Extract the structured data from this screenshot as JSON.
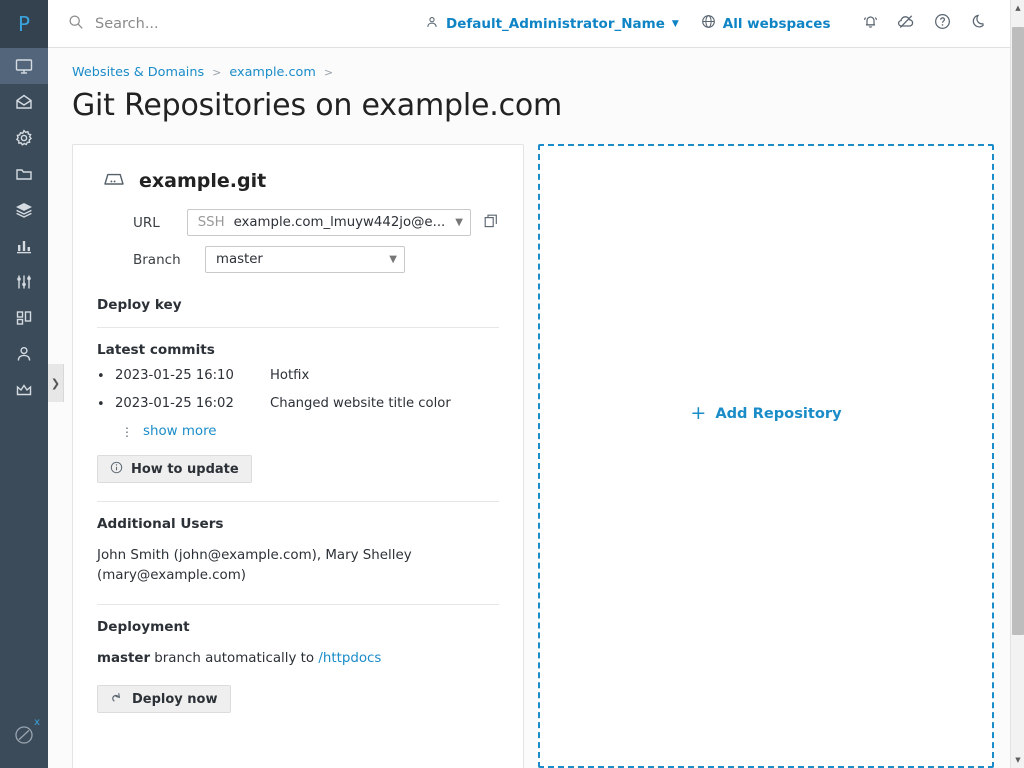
{
  "brand": {
    "logo_letter": "P",
    "accent": "#1a8cc8",
    "sidebar_bg": "#3b4b5a"
  },
  "header": {
    "search_placeholder": "Search...",
    "search_value": "",
    "account_name": "Default_Administrator_Name",
    "webspaces_label": "All webspaces",
    "icons": [
      "user-icon",
      "chevron-down-icon",
      "globe-icon",
      "bell-icon",
      "cloud-slash-icon",
      "help-icon",
      "moon-icon"
    ]
  },
  "sidebar": {
    "items": [
      {
        "name": "websites-and-domains",
        "icon": "monitor-icon",
        "active": true
      },
      {
        "name": "mail",
        "icon": "envelope-icon",
        "active": false
      },
      {
        "name": "applications",
        "icon": "gear-icon",
        "active": false
      },
      {
        "name": "files",
        "icon": "folder-icon",
        "active": false
      },
      {
        "name": "databases",
        "icon": "layers-icon",
        "active": false
      },
      {
        "name": "statistics",
        "icon": "bar-chart-icon",
        "active": false
      },
      {
        "name": "tools-and-settings",
        "icon": "sliders-icon",
        "active": false
      },
      {
        "name": "extensions",
        "icon": "grid-icon",
        "active": false
      },
      {
        "name": "users",
        "icon": "person-icon",
        "active": false
      },
      {
        "name": "licenses",
        "icon": "crown-icon",
        "active": false
      }
    ],
    "bottom_item": {
      "name": "no-entry",
      "icon": "circle-slash-icon",
      "badge": "x"
    },
    "collapse_icon": "chevron-right-icon"
  },
  "breadcrumb": {
    "items": [
      {
        "label": "Websites & Domains"
      },
      {
        "label": "example.com"
      }
    ],
    "separator": ">"
  },
  "page": {
    "title": "Git Repositories on example.com"
  },
  "repository": {
    "icon": "repository-disk-icon",
    "name": "example.git",
    "url": {
      "label": "URL",
      "protocol": "SSH",
      "value": "example.com_lmuyw442jo@e...",
      "copy_icon": "copy-icon",
      "chevron": "chevron-down-icon"
    },
    "branch": {
      "label": "Branch",
      "value": "master",
      "chevron": "chevron-down-icon"
    },
    "deploy_key": {
      "title": "Deploy key"
    },
    "latest_commits": {
      "title": "Latest commits",
      "items": [
        {
          "date": "2023-01-25 16:10",
          "message": "Hotfix"
        },
        {
          "date": "2023-01-25 16:02",
          "message": "Changed website title color"
        }
      ],
      "show_more_label": "show more",
      "show_more_icon": "vertical-dots-icon"
    },
    "how_to_update": {
      "label": "How to update",
      "icon": "info-icon"
    },
    "additional_users": {
      "title": "Additional Users",
      "text": "John Smith (john@example.com), Mary Shelley (mary@example.com)"
    },
    "deployment": {
      "title": "Deployment",
      "branch": "master",
      "text_middle": " branch automatically to ",
      "target": "/httpdocs",
      "deploy_button": {
        "label": "Deploy now",
        "icon": "deploy-arrow-icon"
      }
    }
  },
  "add_repository": {
    "label": "Add Repository",
    "plus": "+"
  },
  "scrollbar": {
    "up_arrow": "▲",
    "down_arrow": "▼"
  }
}
